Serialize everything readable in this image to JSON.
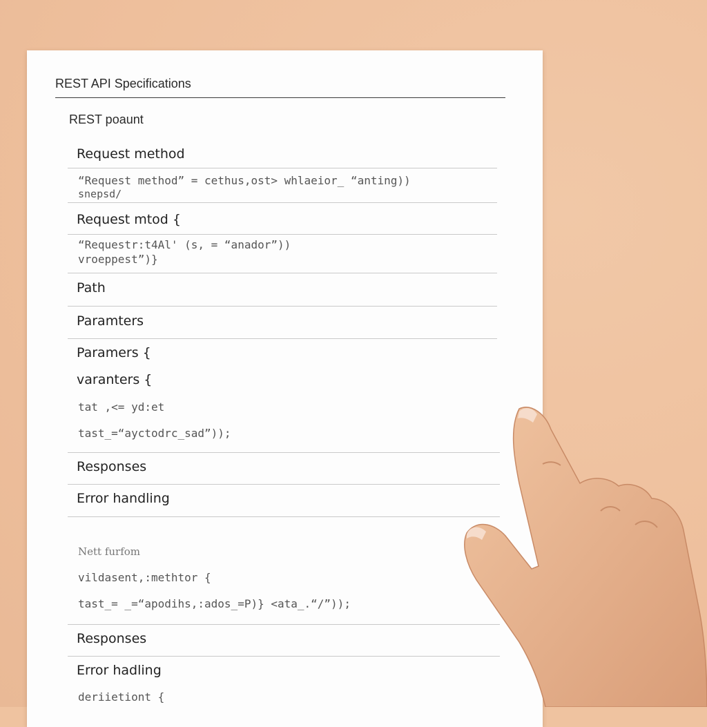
{
  "document": {
    "title": "REST API Specifications",
    "subtitle": "REST poaunt",
    "rows": [
      {
        "label": "Request method"
      },
      {
        "code": "“Request method”  = cethus,ost> whlaeior_ “anting))"
      },
      {
        "code": "snepsd/"
      },
      {
        "label": "Request mtod {"
      },
      {
        "code": "“Requestr:t4Al' (s, = “anador”))"
      },
      {
        "code": "vroeppest”)}"
      },
      {
        "label": "Path"
      },
      {
        "label": "Paramters"
      },
      {
        "label": "Paramers {"
      },
      {
        "label": "varanters {"
      },
      {
        "code": "tat ,<= yd:et"
      },
      {
        "code": "tast_=“ayctodrc_sad”));"
      },
      {
        "label": "Responses"
      },
      {
        "label": "Error handling"
      },
      {
        "note": "Nett furfom"
      },
      {
        "code": "vildasent,:methtor {"
      },
      {
        "code": "tast_= _=“apodihs,:ados_=P)} <ata_.“/”));"
      },
      {
        "label": "Responses"
      },
      {
        "label": "Error hadling"
      },
      {
        "code": "deriietiont {"
      }
    ]
  },
  "colors": {
    "background": "#efc3a0",
    "paper": "#fdfdfd",
    "text": "#222222",
    "rule": "#c9c9c9",
    "skin": "#e7b48f"
  },
  "icons": {
    "hand": "pointing-hand"
  }
}
